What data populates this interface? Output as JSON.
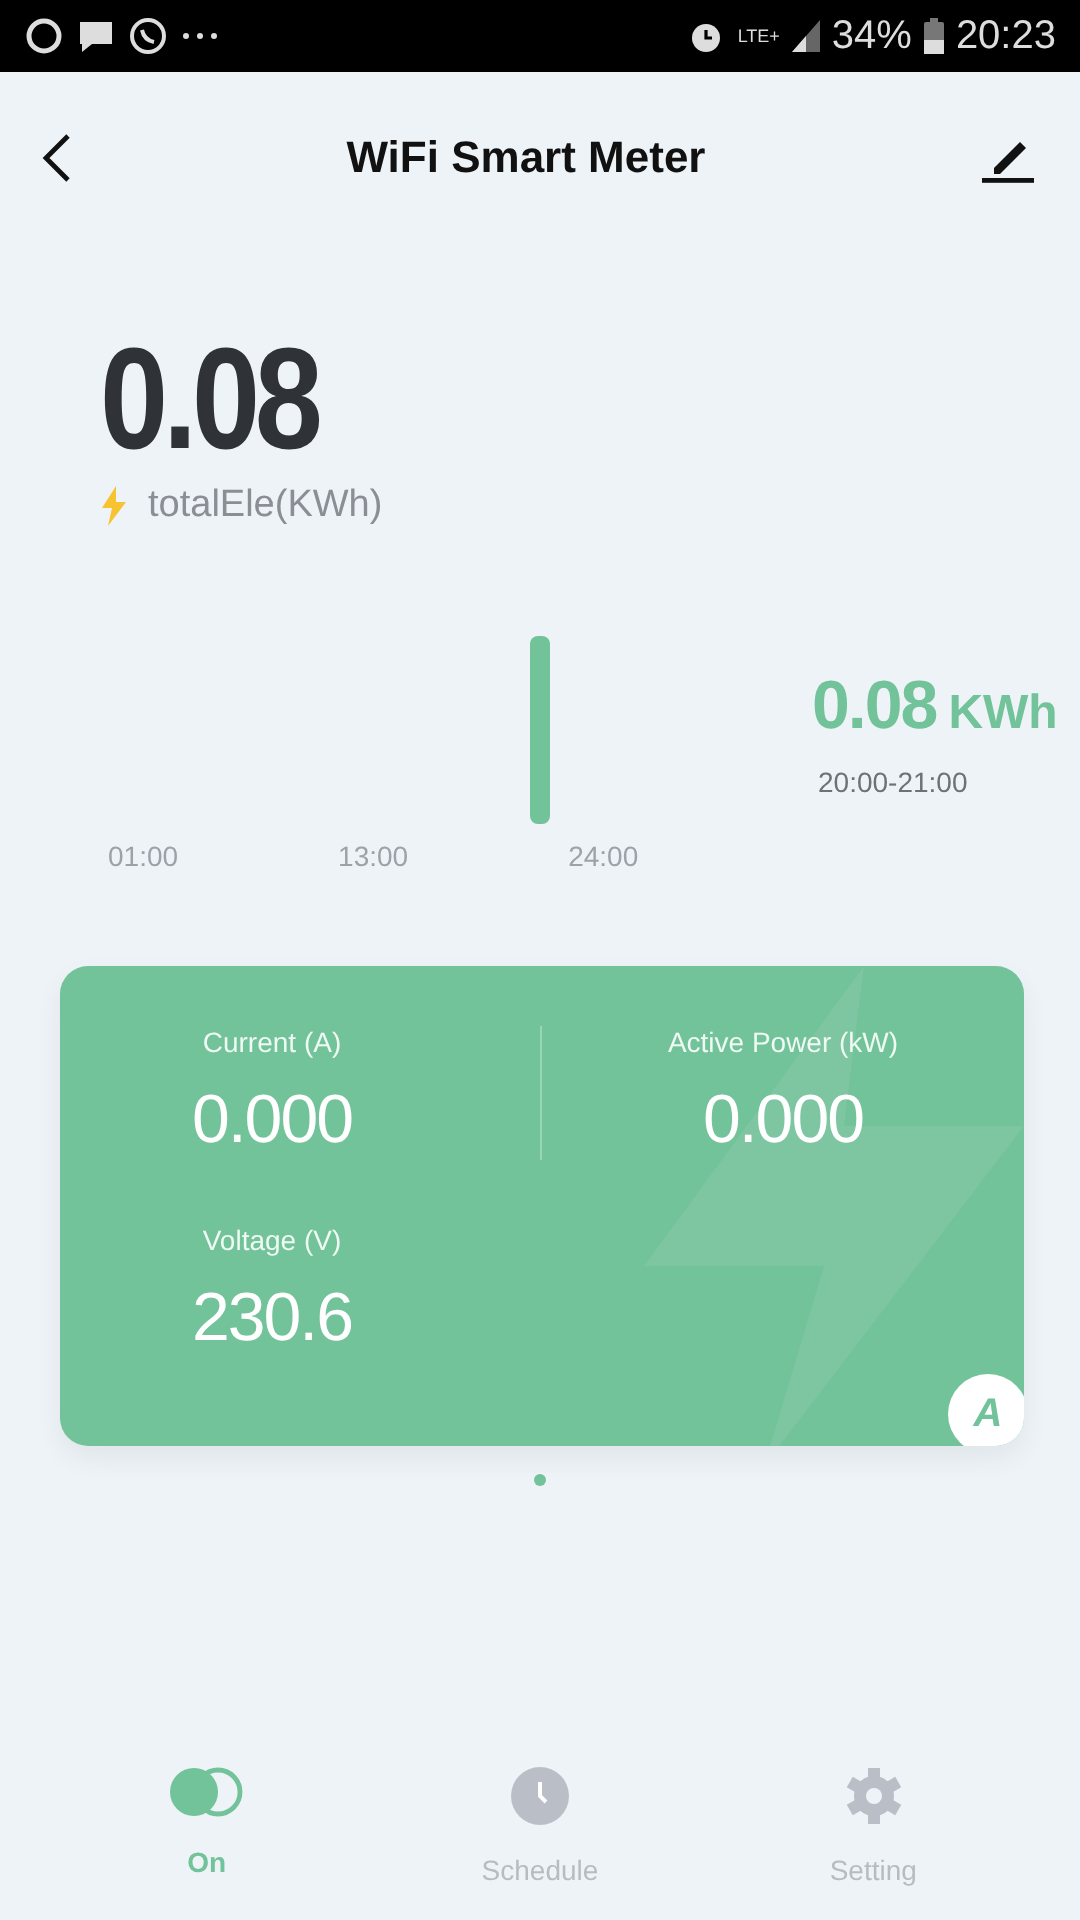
{
  "status_bar": {
    "network": "LTE+",
    "battery": "34%",
    "time": "20:23"
  },
  "header": {
    "title": "WiFi Smart Meter"
  },
  "total": {
    "value": "0.08",
    "label": "totalEle(KWh)"
  },
  "usage": {
    "value": "0.08",
    "unit": "KWh",
    "period": "20:00-21:00",
    "axis_labels": [
      "01:00",
      "13:00",
      "24:00"
    ]
  },
  "metrics": [
    {
      "label": "Current (A)",
      "value": "0.000"
    },
    {
      "label": "Active Power (kW)",
      "value": "0.000"
    },
    {
      "label": "Voltage (V)",
      "value": "230.6"
    }
  ],
  "card_badge": "A",
  "page_dots": [
    {
      "selected": true
    }
  ],
  "tabs": [
    {
      "kind": "power",
      "label": "On",
      "selected": true
    },
    {
      "kind": "schedule",
      "label": "Schedule",
      "selected": false
    },
    {
      "kind": "setting",
      "label": "Setting",
      "selected": false
    }
  ]
}
